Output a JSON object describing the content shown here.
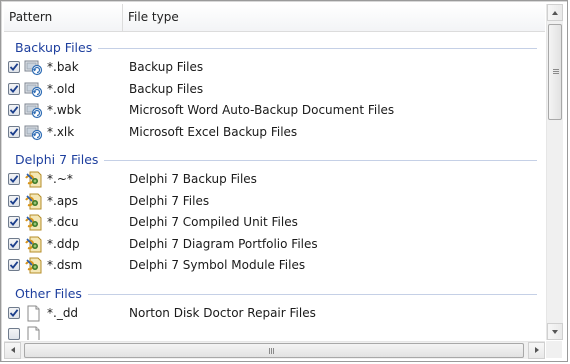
{
  "columns": {
    "pattern": "Pattern",
    "file_type": "File type"
  },
  "groups": [
    {
      "label": "Backup Files",
      "icon": "backup-file-icon",
      "items": [
        {
          "pattern": "*.bak",
          "type": "Backup Files",
          "checked": true
        },
        {
          "pattern": "*.old",
          "type": "Backup Files",
          "checked": true
        },
        {
          "pattern": "*.wbk",
          "type": "Microsoft Word Auto-Backup Document Files",
          "checked": true
        },
        {
          "pattern": "*.xlk",
          "type": "Microsoft Excel Backup Files",
          "checked": true
        }
      ]
    },
    {
      "label": "Delphi 7 Files",
      "icon": "delphi-file-icon",
      "items": [
        {
          "pattern": "*.~*",
          "type": "Delphi 7 Backup Files",
          "checked": true
        },
        {
          "pattern": "*.aps",
          "type": "Delphi 7 Files",
          "checked": true
        },
        {
          "pattern": "*.dcu",
          "type": "Delphi 7 Compiled Unit Files",
          "checked": true
        },
        {
          "pattern": "*.ddp",
          "type": "Delphi 7 Diagram Portfolio Files",
          "checked": true
        },
        {
          "pattern": "*.dsm",
          "type": "Delphi 7 Symbol Module Files",
          "checked": true
        }
      ]
    },
    {
      "label": "Other Files",
      "icon": "blank-file-icon",
      "items": [
        {
          "pattern": "*._dd",
          "type": "Norton Disk Doctor Repair Files",
          "checked": true
        },
        {
          "pattern": "",
          "type": "",
          "checked": false
        }
      ]
    }
  ],
  "colors": {
    "group_label": "#1e3f9e",
    "group_line": "#c5d0e6",
    "checkmark": "#1c3f8c"
  },
  "scrollbars": {
    "vertical_position": 0.0,
    "horizontal_position": 0.0
  }
}
